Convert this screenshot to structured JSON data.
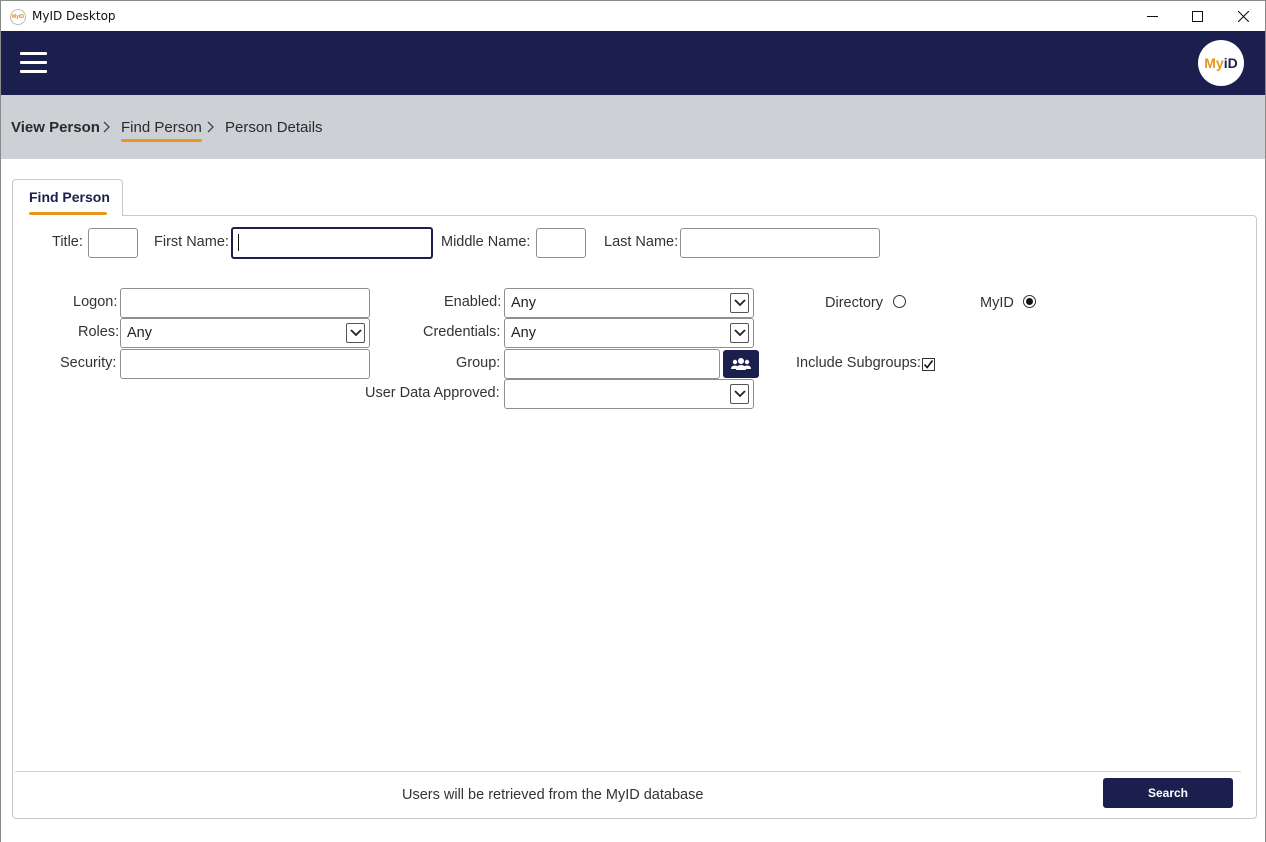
{
  "window": {
    "title": "MyID Desktop",
    "app_icon_text": "MyID",
    "controls": [
      "minimize-icon",
      "maximize-icon",
      "close-icon"
    ]
  },
  "header": {
    "menu_icon": "hamburger-menu-icon",
    "logo": {
      "my": "My",
      "id": "iD"
    },
    "background_color": "#1b1f4d",
    "accent_color": "#e8961e"
  },
  "breadcrumb": {
    "items": [
      "View Person",
      "Find Person",
      "Person Details"
    ],
    "separator": ">",
    "active_index": 1
  },
  "tab": {
    "label": "Find Person"
  },
  "form": {
    "title_label": "Title:",
    "title_value": "",
    "first_name_label": "First Name:",
    "first_name_value": "",
    "middle_name_label": "Middle Name:",
    "middle_name_value": "",
    "last_name_label": "Last Name:",
    "last_name_value": "",
    "logon_label": "Logon:",
    "logon_value": "",
    "roles_label": "Roles:",
    "roles_value": "Any",
    "security_label": "Security:",
    "security_value": "",
    "enabled_label": "Enabled:",
    "enabled_value": "Any",
    "credentials_label": "Credentials:",
    "credentials_value": "Any",
    "group_label": "Group:",
    "group_value": "",
    "group_button_icon": "people-group-icon",
    "user_data_approved_label": "User Data Approved:",
    "user_data_approved_value": "",
    "source_options": [
      {
        "label": "Directory",
        "selected": false
      },
      {
        "label": "MyID",
        "selected": true
      }
    ],
    "include_subgroups_label": "Include Subgroups:",
    "include_subgroups_checked": true
  },
  "footer": {
    "message": "Users will be retrieved from the MyID database",
    "search_label": "Search"
  }
}
